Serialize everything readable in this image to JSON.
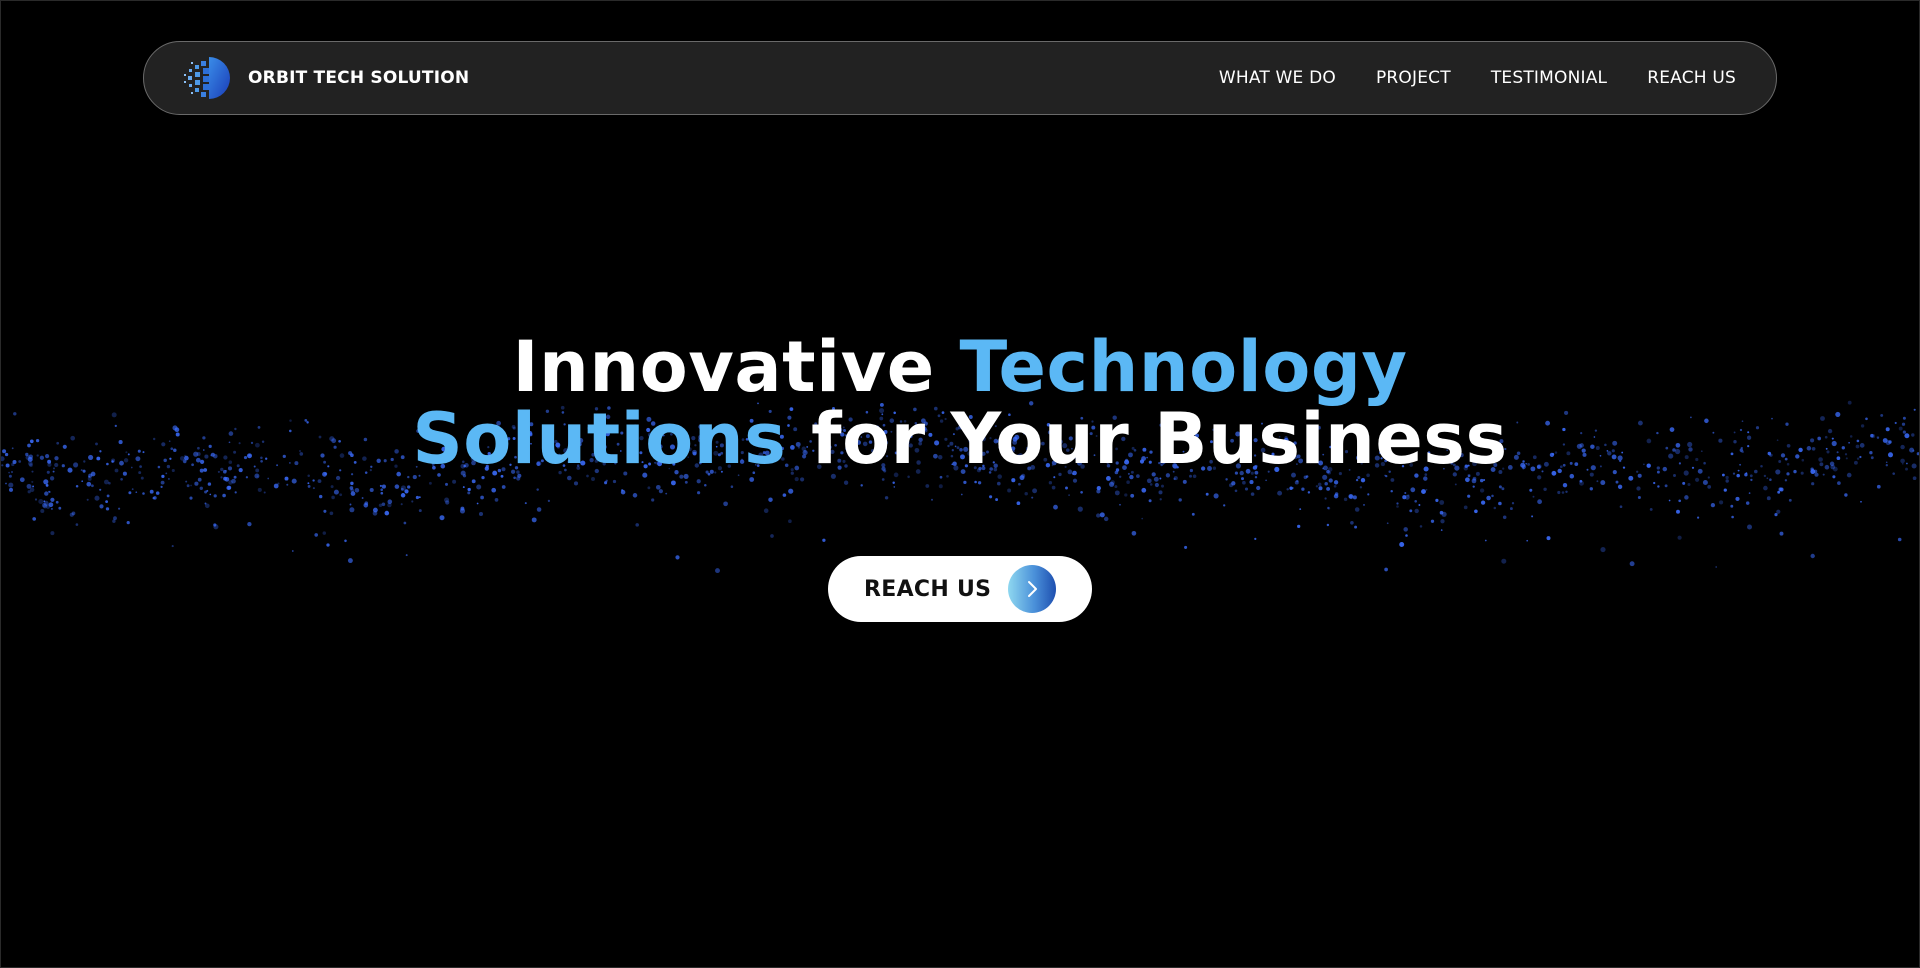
{
  "brand": {
    "name": "ORBIT TECH SOLUTION",
    "logo_icon": "orbit-logo-icon"
  },
  "nav": {
    "items": [
      {
        "label": "WHAT WE DO"
      },
      {
        "label": "PROJECT"
      },
      {
        "label": "TESTIMONIAL"
      },
      {
        "label": "REACH US"
      }
    ]
  },
  "hero": {
    "title_part1": "Innovative ",
    "title_accent1": "Technology",
    "title_accent2": "Solutions",
    "title_part2": " for Your Business",
    "cta_label": "REACH US",
    "cta_icon": "chevron-right-icon"
  },
  "colors": {
    "background": "#000000",
    "navbar": "#222222",
    "accent": "#5bb8f5",
    "particles": "#3b6dff",
    "cta_background": "#ffffff"
  }
}
